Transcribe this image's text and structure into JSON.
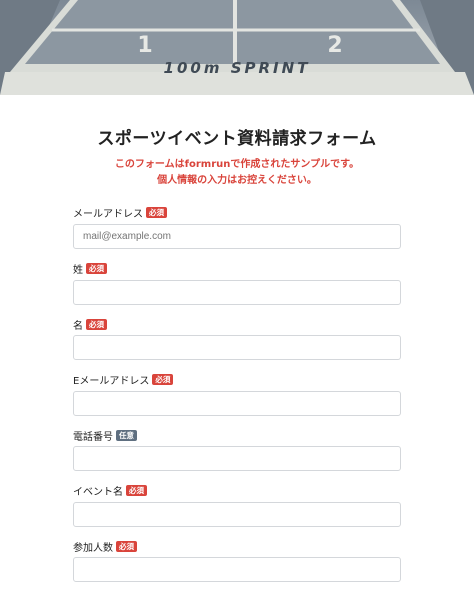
{
  "hero": {
    "lane_numbers": [
      "1",
      "2"
    ],
    "track_text": "100m SPRINT"
  },
  "form": {
    "title": "スポーツイベント資料請求フォーム",
    "note_line1": "このフォームはformrunで作成されたサンプルです。",
    "note_line2": "個人情報の入力はお控えください。",
    "required_label": "必須",
    "optional_label": "任意",
    "fields": [
      {
        "label": "メールアドレス",
        "badge": "必須",
        "placeholder": "mail@example.com",
        "value": ""
      },
      {
        "label": "姓",
        "badge": "必須",
        "placeholder": "",
        "value": ""
      },
      {
        "label": "名",
        "badge": "必須",
        "placeholder": "",
        "value": ""
      },
      {
        "label": "Eメールアドレス",
        "badge": "必須",
        "placeholder": "",
        "value": ""
      },
      {
        "label": "電話番号",
        "badge": "任意",
        "placeholder": "",
        "value": ""
      },
      {
        "label": "イベント名",
        "badge": "必須",
        "placeholder": "",
        "value": ""
      },
      {
        "label": "参加人数",
        "badge": "必須",
        "placeholder": "",
        "value": ""
      }
    ]
  },
  "colors": {
    "accent_red": "#d9443b",
    "optional_badge": "#5f6f80"
  }
}
